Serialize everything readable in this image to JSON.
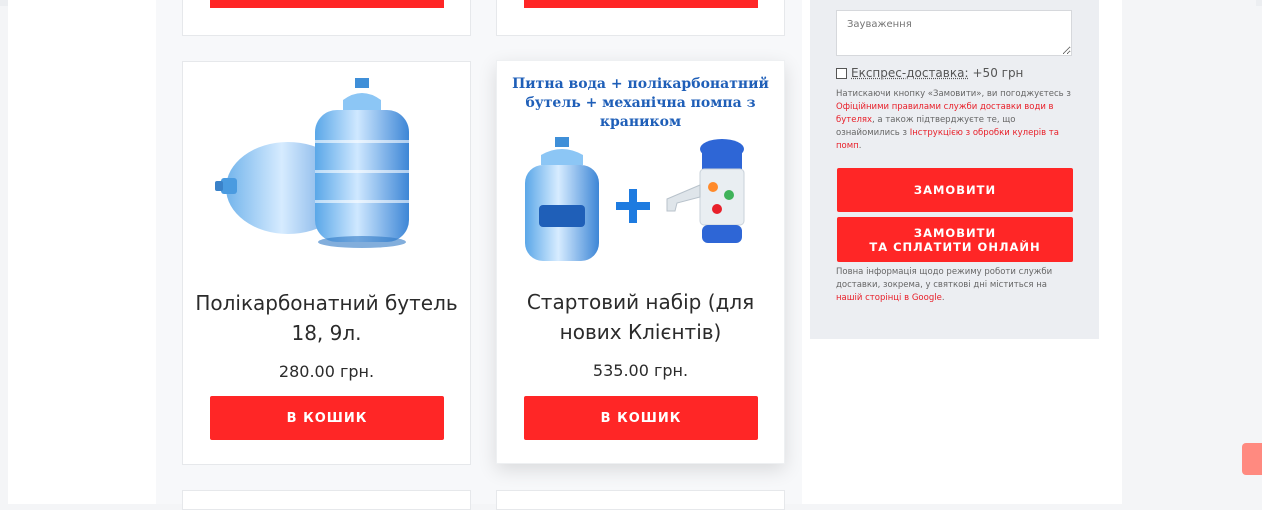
{
  "products": [
    {
      "title": "Полікарбонатний бутель 18, 9л.",
      "price": "280.00 грн.",
      "button": "В КОШИК",
      "image_icon": "water-bottle-18-9l"
    },
    {
      "title": "Стартовий набір (для нових Клієнтів)",
      "price": "535.00 грн.",
      "button": "В КОШИК",
      "image_headline": "Питна вода + полікарбонатний бутель + механічна помпа з краником",
      "image_plus": "+"
    }
  ],
  "order_form": {
    "notes_placeholder": "Зауваження",
    "express_label": "Експрес-доставка:",
    "express_price": "+50 грн",
    "terms": {
      "part1": "Натискаючи кнопку «Замовити», ви погоджуєтесь з ",
      "link1": "Офіційними правилами служби доставки води в бутелях",
      "part2": ", а також підтверджуєте те, що ознайомились з ",
      "link2": "Інструкцією з обробки кулерів та помп",
      "part3": "."
    },
    "order_button": "ЗАМОВИТИ",
    "order_pay_button_line1": "ЗАМОВИТИ",
    "order_pay_button_line2": "ТА СПЛАТИТИ ОНЛАЙН",
    "info": {
      "part1": "Повна інформація щодо режиму роботи служби доставки, зокрема, у святкові дні міститься на ",
      "link": "нашій сторінці в Google",
      "part2": "."
    }
  },
  "colors": {
    "accent": "#ff2626",
    "link": "#e8202a",
    "sidebar_bg": "#eceef2"
  }
}
